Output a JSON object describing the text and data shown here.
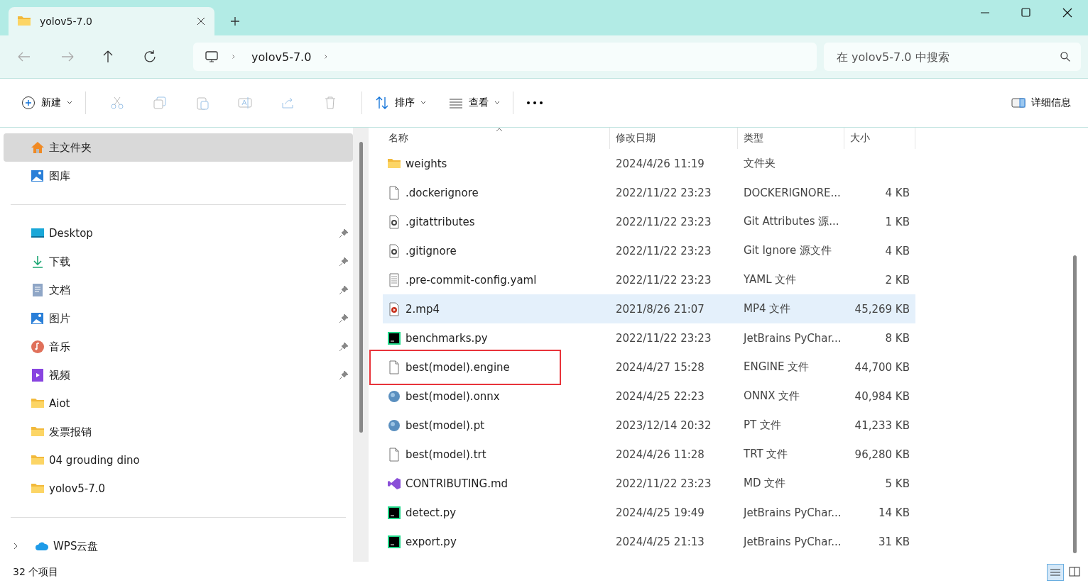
{
  "tabs": [
    {
      "title": "yolov5-7.0",
      "selected": true
    }
  ],
  "nav": {
    "breadcrumb": [
      "yolov5-7.0"
    ]
  },
  "search": {
    "placeholder": "在 yolov5-7.0 中搜索"
  },
  "toolbar": {
    "new": "新建",
    "sort": "排序",
    "view": "查看",
    "details": "详细信息"
  },
  "sidebar": {
    "groups": [
      [
        {
          "label": "主文件夹",
          "kind": "home",
          "selected": true,
          "pinned": false
        },
        {
          "label": "图库",
          "kind": "gallery",
          "selected": false,
          "pinned": false
        }
      ],
      [
        {
          "label": "Desktop",
          "kind": "desktop",
          "selected": false,
          "pinned": true
        },
        {
          "label": "下载",
          "kind": "download",
          "selected": false,
          "pinned": true
        },
        {
          "label": "文档",
          "kind": "document",
          "selected": false,
          "pinned": true
        },
        {
          "label": "图片",
          "kind": "gallery",
          "selected": false,
          "pinned": true
        },
        {
          "label": "音乐",
          "kind": "music",
          "selected": false,
          "pinned": true
        },
        {
          "label": "视频",
          "kind": "video",
          "selected": false,
          "pinned": true
        },
        {
          "label": "Aiot",
          "kind": "folder",
          "selected": false,
          "pinned": false
        },
        {
          "label": "发票报销",
          "kind": "folder",
          "selected": false,
          "pinned": false
        },
        {
          "label": "04 grouding dino",
          "kind": "folder",
          "selected": false,
          "pinned": false
        },
        {
          "label": "yolov5-7.0",
          "kind": "folder",
          "selected": false,
          "pinned": false
        }
      ],
      [
        {
          "label": "WPS云盘",
          "kind": "cloud",
          "selected": false,
          "pinned": false,
          "expandable": true
        }
      ]
    ]
  },
  "table": {
    "columns": [
      "名称",
      "修改日期",
      "类型",
      "大小"
    ],
    "rows": [
      {
        "kind": "folder",
        "name": "weights",
        "date": "2024/4/26 11:19",
        "type": "文件夹",
        "selected": false,
        "annotated": false
      },
      {
        "kind": "file",
        "name": ".dockerignore",
        "date": "2022/11/22 23:23",
        "type": "DOCKERIGNORE...",
        "size": "4 KB",
        "selected": false,
        "annotated": false
      },
      {
        "kind": "config",
        "name": ".gitattributes",
        "date": "2022/11/22 23:23",
        "type": "Git Attributes 源...",
        "size": "1 KB",
        "selected": false,
        "annotated": false
      },
      {
        "kind": "config",
        "name": ".gitignore",
        "date": "2022/11/22 23:23",
        "type": "Git Ignore 源文件",
        "size": "4 KB",
        "selected": false,
        "annotated": false
      },
      {
        "kind": "text",
        "name": ".pre-commit-config.yaml",
        "date": "2022/11/22 23:23",
        "type": "YAML 文件",
        "size": "2 KB",
        "selected": false,
        "annotated": false
      },
      {
        "kind": "media",
        "name": "2.mp4",
        "date": "2021/8/26 21:07",
        "type": "MP4 文件",
        "size": "45,269 KB",
        "selected": true,
        "annotated": false
      },
      {
        "kind": "python",
        "name": "benchmarks.py",
        "date": "2022/11/22 23:23",
        "type": "JetBrains PyChar...",
        "size": "8 KB",
        "selected": false,
        "annotated": false
      },
      {
        "kind": "file",
        "name": "best(model).engine",
        "date": "2024/4/27 15:28",
        "type": "ENGINE 文件",
        "size": "44,700 KB",
        "selected": false,
        "annotated": true
      },
      {
        "kind": "sphere",
        "name": "best(model).onnx",
        "date": "2024/4/25 22:23",
        "type": "ONNX 文件",
        "size": "40,984 KB",
        "selected": false,
        "annotated": false
      },
      {
        "kind": "sphere",
        "name": "best(model).pt",
        "date": "2023/12/14 20:32",
        "type": "PT 文件",
        "size": "41,233 KB",
        "selected": false,
        "annotated": false
      },
      {
        "kind": "file",
        "name": "best(model).trt",
        "date": "2024/4/26 11:28",
        "type": "TRT 文件",
        "size": "96,280 KB",
        "selected": false,
        "annotated": false
      },
      {
        "kind": "studio",
        "name": "CONTRIBUTING.md",
        "date": "2022/11/22 23:23",
        "type": "MD 文件",
        "size": "5 KB",
        "selected": false,
        "annotated": false
      },
      {
        "kind": "python",
        "name": "detect.py",
        "date": "2024/4/25 19:49",
        "type": "JetBrains PyChar...",
        "size": "14 KB",
        "selected": false,
        "annotated": false
      },
      {
        "kind": "python",
        "name": "export.py",
        "date": "2024/4/25 21:13",
        "type": "JetBrains PyChar...",
        "size": "31 KB",
        "selected": false,
        "annotated": false
      }
    ]
  },
  "status_bar": {
    "count": "32 个项目"
  }
}
